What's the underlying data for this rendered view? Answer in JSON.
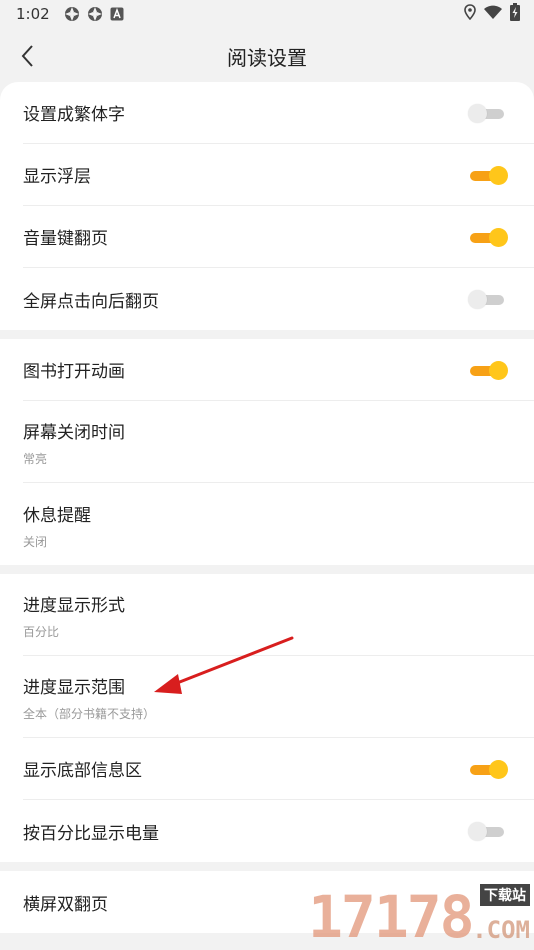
{
  "status_bar": {
    "time": "1:02",
    "left_icons": [
      "settings-icon",
      "settings-icon",
      "text-a-icon"
    ],
    "right_icons": [
      "location-icon",
      "wifi-icon",
      "battery-charging-icon"
    ]
  },
  "header": {
    "back_icon": "chevron-left-icon",
    "title": "阅读设置"
  },
  "accent_color": "#ffc61a",
  "groups": [
    [
      {
        "label": "设置成繁体字",
        "toggle": false
      },
      {
        "label": "显示浮层",
        "toggle": true
      },
      {
        "label": "音量键翻页",
        "toggle": true
      },
      {
        "label": "全屏点击向后翻页",
        "toggle": false
      }
    ],
    [
      {
        "label": "图书打开动画",
        "toggle": true
      },
      {
        "label": "屏幕关闭时间",
        "sub": "常亮"
      },
      {
        "label": "休息提醒",
        "sub": "关闭"
      }
    ],
    [
      {
        "label": "进度显示形式",
        "sub": "百分比"
      },
      {
        "label": "进度显示范围",
        "sub": "全本（部分书籍不支持）"
      },
      {
        "label": "显示底部信息区",
        "toggle": true
      },
      {
        "label": "按百分比显示电量",
        "toggle": false
      }
    ],
    [
      {
        "label": "横屏双翻页"
      }
    ]
  ],
  "watermark": {
    "number": "17178",
    "site": "下载站",
    "domain": ".COM"
  }
}
